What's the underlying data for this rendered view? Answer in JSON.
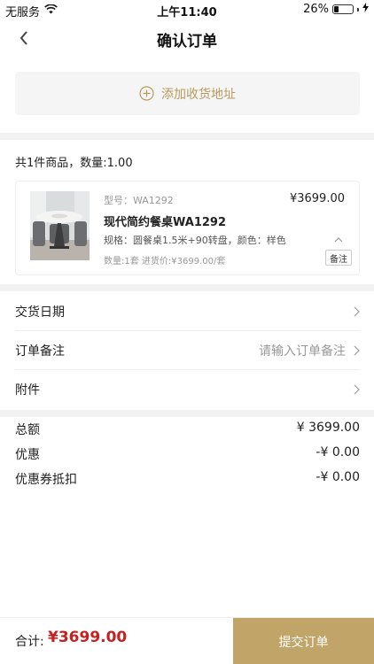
{
  "status_bar": {
    "carrier": "无服务",
    "time": "上午11:40",
    "battery": "26%",
    "battery_level": 0.26
  },
  "nav": {
    "title": "确认订单"
  },
  "address": {
    "add_label": "添加收货地址"
  },
  "summary": {
    "text": "共1件商品，数量:1.00"
  },
  "product": {
    "model": "型号：WA1292",
    "price": "¥3699.00",
    "name": "现代简约餐桌WA1292",
    "spec": "规格：圆餐桌1.5米+90转盘，颜色：样色",
    "qty_price": "数量:1套  进货价:¥3699.00/套",
    "note_button": "备注"
  },
  "rows": {
    "delivery_date": "交货日期",
    "order_note": "订单备注",
    "order_note_placeholder": "请输入订单备注",
    "attachment": "附件"
  },
  "totals": {
    "total_label": "总额",
    "total_value": "¥ 3699.00",
    "discount_label": "优惠",
    "discount_value": "-¥ 0.00",
    "coupon_label": "优惠券抵扣",
    "coupon_value": "-¥ 0.00"
  },
  "footer": {
    "sum_label": "合计:",
    "sum_value": "¥3699.00",
    "submit": "提交订单"
  },
  "colors": {
    "accent": "#c1a468",
    "price_red": "#c62020"
  }
}
